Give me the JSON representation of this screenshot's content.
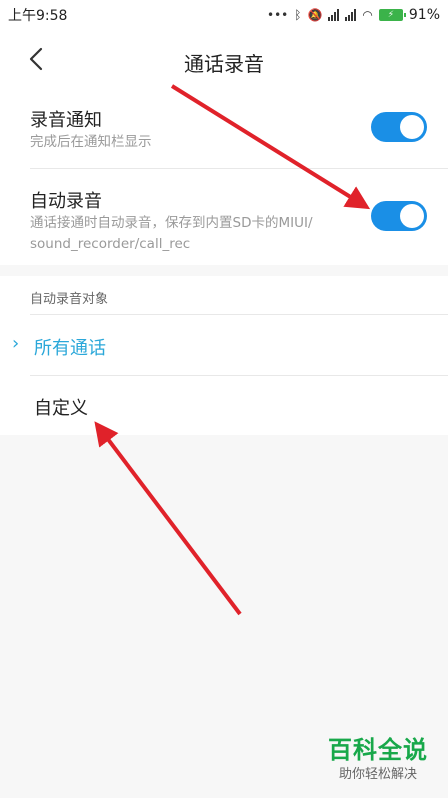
{
  "status_bar": {
    "time": "上午9:58",
    "battery": "91%"
  },
  "header": {
    "title": "通话录音"
  },
  "settings": [
    {
      "title": "录音通知",
      "subtitle": "完成后在通知栏显示",
      "enabled": true
    },
    {
      "title": "自动录音",
      "subtitle_line1": "通话接通时自动录音，保存到内置SD卡的MIUI/",
      "subtitle_line2": "sound_recorder/call_rec",
      "enabled": true
    }
  ],
  "auto_record_target": {
    "label": "自动录音对象",
    "options": [
      {
        "label": "所有通话",
        "selected": true
      },
      {
        "label": "自定义",
        "selected": false
      }
    ]
  },
  "watermark": {
    "main": "百科全说",
    "sub": "助你轻松解决"
  },
  "colors": {
    "accent": "#1a8fe6",
    "selected_text": "#2aa7d9",
    "arrow": "#e0222a",
    "watermark": "#18a84a"
  }
}
